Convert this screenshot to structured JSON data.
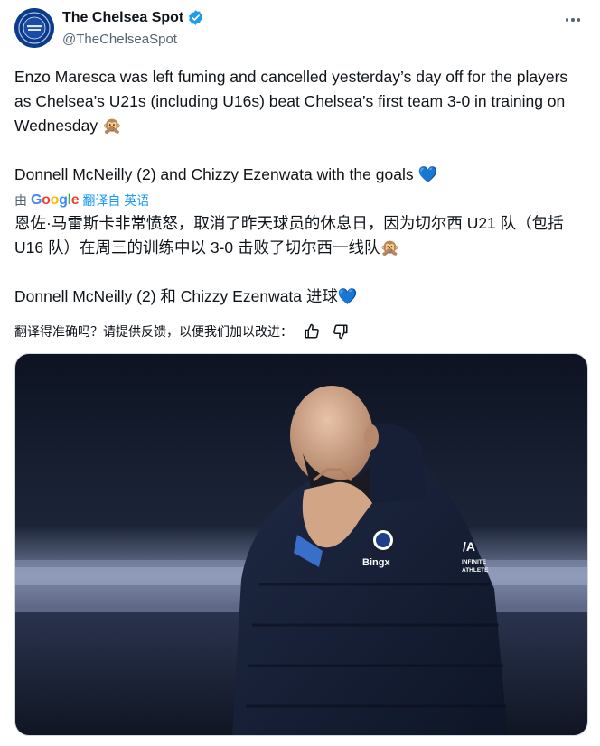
{
  "author": {
    "display_name": "The Chelsea Spot",
    "handle": "@TheChelseaSpot",
    "verified": true,
    "avatar_icon": "chelsea-spot-avatar"
  },
  "tweet": {
    "paragraph_1": "Enzo Maresca was left fuming and cancelled yesterday’s day off for the players as Chelsea’s U21s (including U16s) beat Chelsea’s first team 3-0 in training on Wednesday 🙊",
    "paragraph_2": "Donnell McNeilly (2) and Chizzy Ezenwata with the goals 💙"
  },
  "translation": {
    "by_label": "由",
    "provider": "Google",
    "source_link": "翻译自 英语",
    "paragraph_1": "恩佐·马雷斯卡非常愤怒，取消了昨天球员的休息日，因为切尔西 U21 队（包括 U16 队）在周三的训练中以 3-0 击败了切尔西一线队🙊",
    "paragraph_2": "Donnell McNeilly (2) 和 Chizzy Ezenwata 进球💙"
  },
  "feedback": {
    "prompt": "翻译得准确吗？请提供反馈，以便我们加以改进："
  },
  "media": {
    "jacket_text_brand": "Bingx",
    "jacket_text_sponsor_line1": "INFINITE",
    "jacket_text_sponsor_line2": "ATHLETE",
    "badge_icon": "chelsea-crest-icon"
  },
  "colors": {
    "link": "#1d9bf0",
    "secondary_text": "#536471",
    "verified": "#1d9bf0"
  }
}
